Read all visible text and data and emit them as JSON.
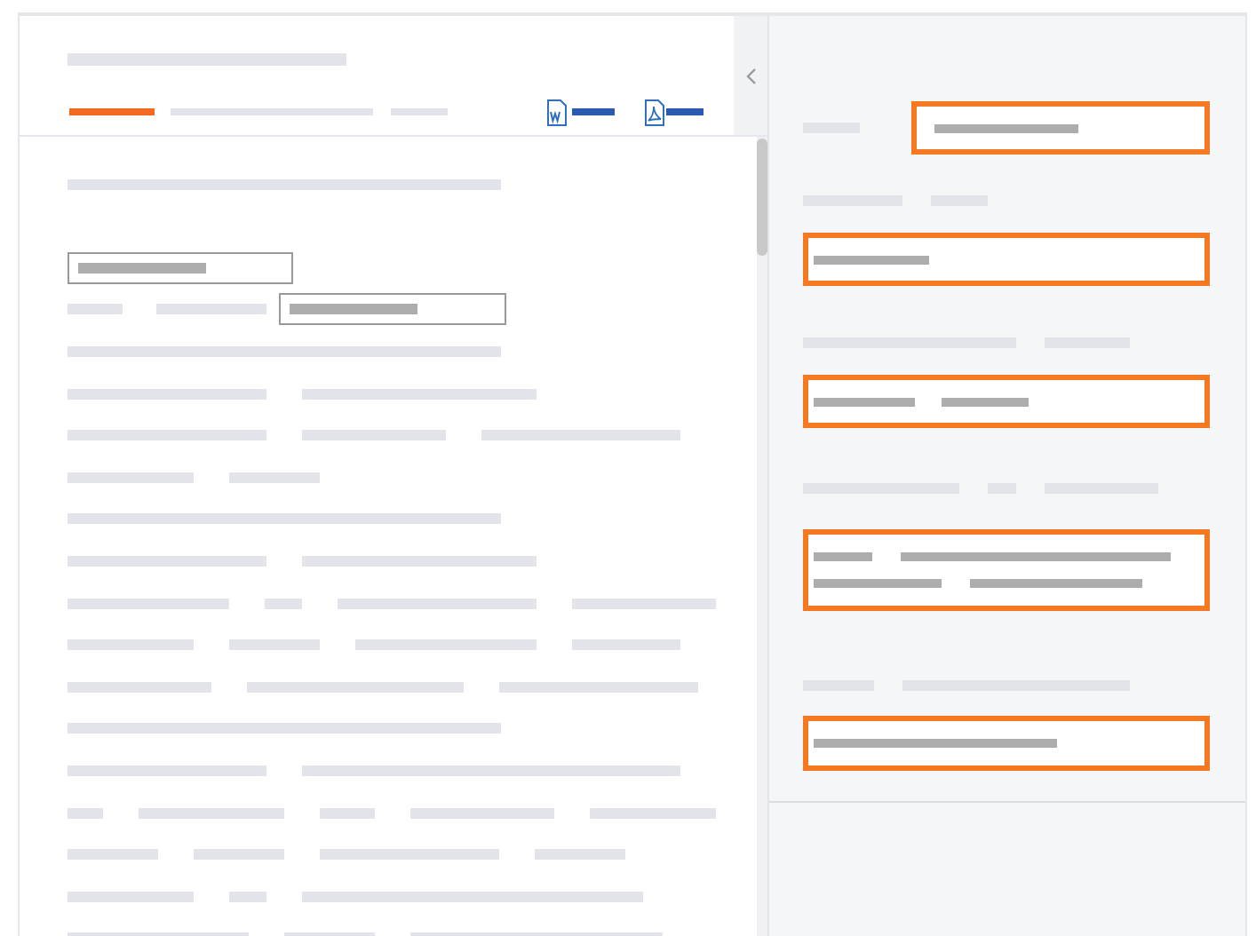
{
  "header": {
    "downloads": [
      {
        "kind": "word"
      },
      {
        "kind": "pdf"
      }
    ]
  },
  "document": {
    "lines": [
      {
        "segments": [
          {
            "boxed": false
          }
        ]
      },
      {
        "segments": [
          {
            "boxed": true
          }
        ]
      },
      {
        "segments": [
          {
            "boxed": false
          },
          {
            "boxed": false
          },
          {
            "boxed": true
          }
        ]
      },
      {
        "segments": [
          {
            "boxed": false
          }
        ]
      },
      {
        "segments": [
          {
            "boxed": false
          },
          {
            "boxed": false
          }
        ]
      },
      {
        "segments": [
          {
            "boxed": false
          },
          {
            "boxed": false
          },
          {
            "boxed": false
          }
        ]
      },
      {
        "segments": [
          {
            "boxed": false
          },
          {
            "boxed": false
          }
        ]
      },
      {
        "segments": [
          {
            "boxed": false
          }
        ]
      },
      {
        "segments": [
          {
            "boxed": false
          },
          {
            "boxed": false
          }
        ]
      },
      {
        "segments": [
          {
            "boxed": false
          },
          {
            "boxed": false
          },
          {
            "boxed": false
          },
          {
            "boxed": false
          }
        ]
      },
      {
        "segments": [
          {
            "boxed": false
          },
          {
            "boxed": false
          },
          {
            "boxed": false
          },
          {
            "boxed": false
          }
        ]
      },
      {
        "segments": [
          {
            "boxed": false
          },
          {
            "boxed": false
          },
          {
            "boxed": false
          }
        ]
      },
      {
        "segments": [
          {
            "boxed": false
          }
        ]
      },
      {
        "segments": [
          {
            "boxed": false
          },
          {
            "boxed": false
          }
        ]
      },
      {
        "segments": [
          {
            "boxed": false
          },
          {
            "boxed": false
          },
          {
            "boxed": false
          },
          {
            "boxed": false
          },
          {
            "boxed": false
          }
        ]
      },
      {
        "segments": [
          {
            "boxed": false
          },
          {
            "boxed": false
          },
          {
            "boxed": false
          },
          {
            "boxed": false
          }
        ]
      },
      {
        "segments": [
          {
            "boxed": false
          },
          {
            "boxed": false
          },
          {
            "boxed": false
          }
        ]
      },
      {
        "segments": [
          {
            "boxed": false
          },
          {
            "boxed": false
          },
          {
            "boxed": false
          }
        ]
      }
    ]
  },
  "form": {
    "fields": [
      {
        "inline": true,
        "highlighted": true,
        "label": [
          {
            "dark": false
          }
        ],
        "value": [
          [
            {
              "dark": true
            }
          ]
        ]
      },
      {
        "inline": false,
        "highlighted": true,
        "label": [
          {
            "dark": false
          },
          {
            "dark": false
          }
        ],
        "value": [
          [
            {
              "dark": true
            }
          ]
        ]
      },
      {
        "inline": false,
        "highlighted": true,
        "label": [
          {
            "dark": false
          },
          {
            "dark": false
          }
        ],
        "value": [
          [
            {
              "dark": true
            },
            {
              "dark": true
            }
          ]
        ]
      },
      {
        "inline": false,
        "highlighted": true,
        "label": [
          {
            "dark": false
          },
          {
            "dark": false
          },
          {
            "dark": false
          }
        ],
        "value": [
          [
            {
              "dark": true
            },
            {
              "dark": true
            }
          ],
          [
            {
              "dark": true
            },
            {
              "dark": true
            }
          ]
        ]
      },
      {
        "inline": false,
        "highlighted": true,
        "label": [
          {
            "dark": false
          },
          {
            "dark": false
          }
        ],
        "value": [
          [
            {
              "dark": true
            }
          ]
        ]
      }
    ]
  }
}
